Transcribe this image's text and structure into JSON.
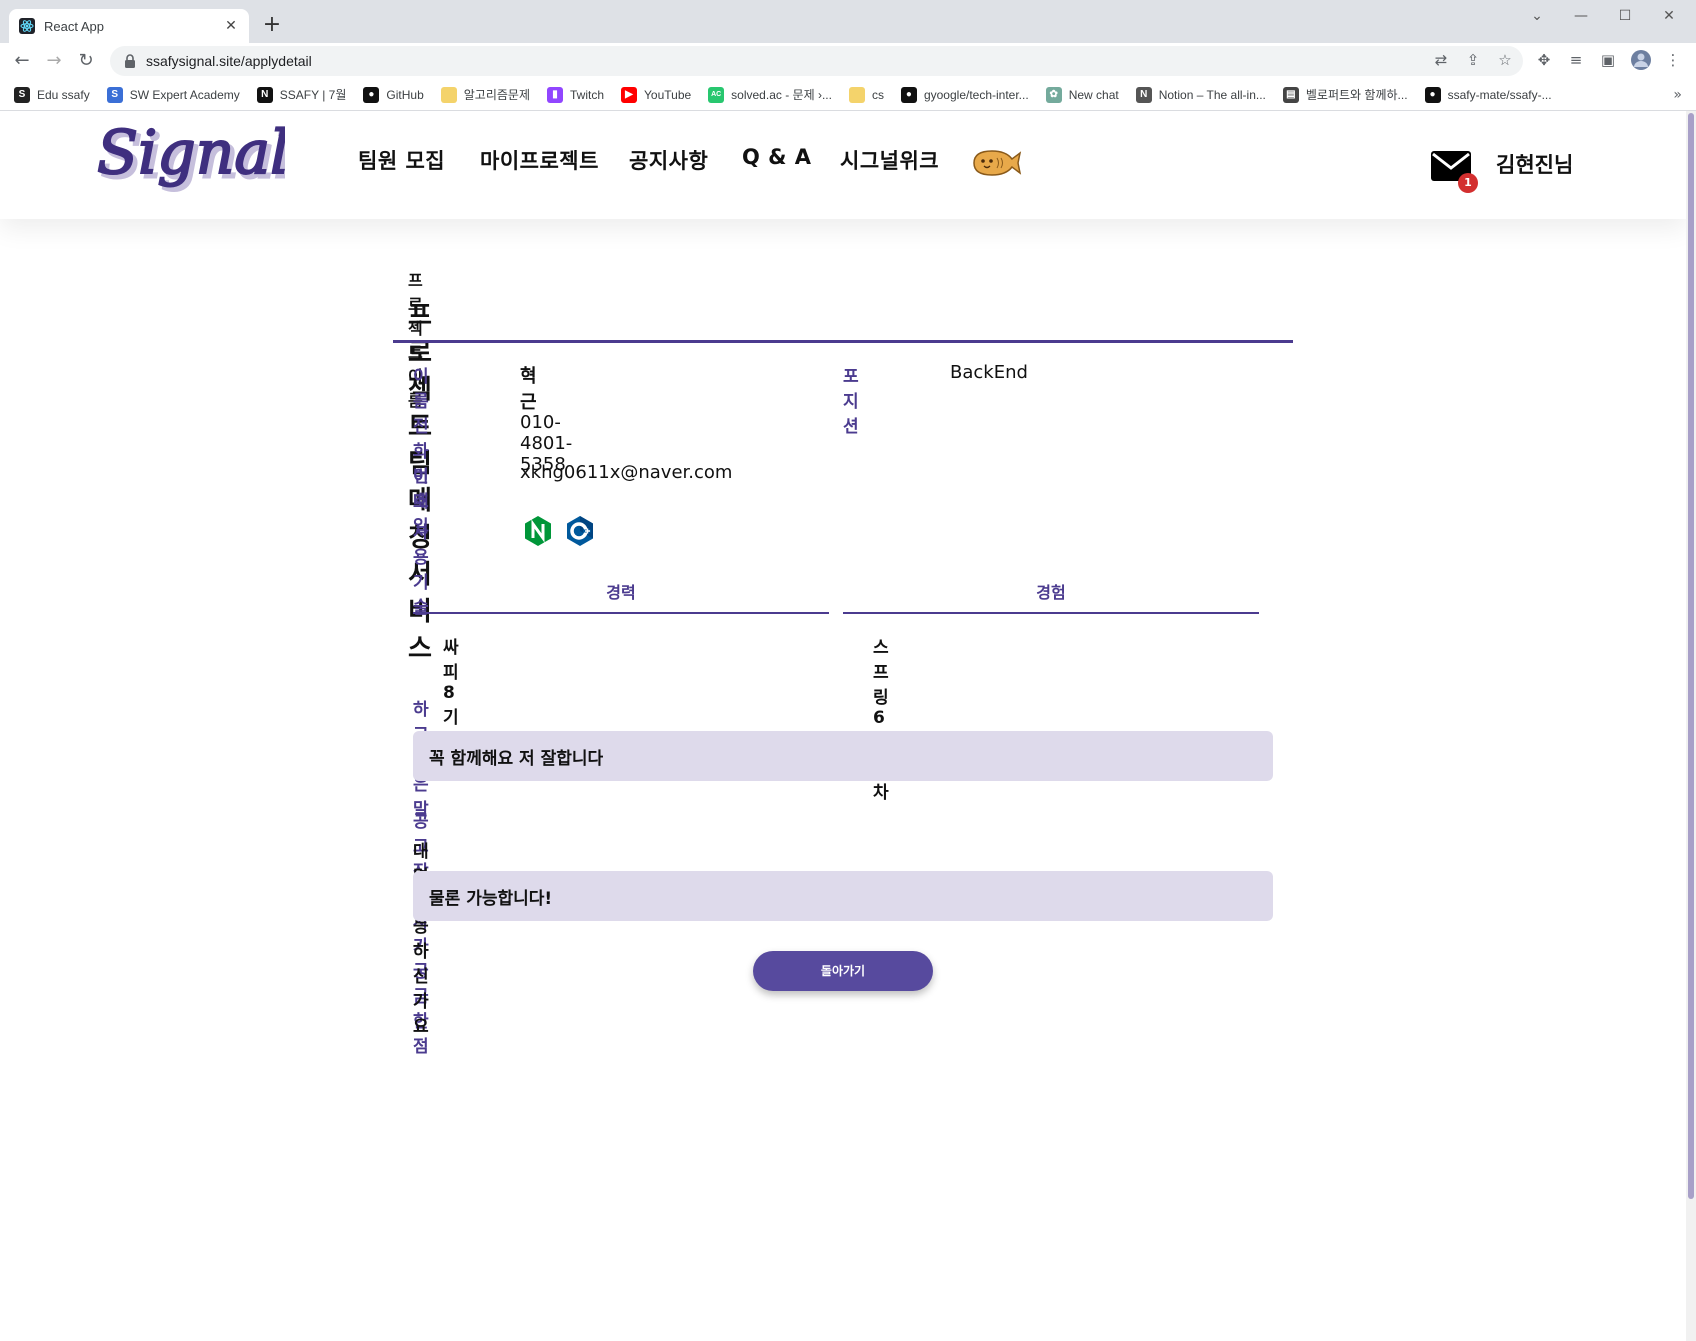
{
  "browser": {
    "tab_title": "React App",
    "url": "ssafysignal.site/applydetail",
    "bookmarks": [
      {
        "label": "Edu ssafy",
        "icon": "edu-ssafy-icon",
        "color": "#222222"
      },
      {
        "label": "SW Expert Academy",
        "icon": "swea-icon",
        "color": "#3b6fd6"
      },
      {
        "label": "SSAFY | 7월",
        "icon": "notion-icon",
        "color": "#111111"
      },
      {
        "label": "GitHub",
        "icon": "github-icon",
        "color": "#111111"
      },
      {
        "label": "알고리즘문제",
        "icon": "folder-icon",
        "color": "#f4d36b"
      },
      {
        "label": "Twitch",
        "icon": "twitch-icon",
        "color": "#9146ff"
      },
      {
        "label": "YouTube",
        "icon": "youtube-icon",
        "color": "#ff0000"
      },
      {
        "label": "solved.ac - 문제 ›...",
        "icon": "solvedac-icon",
        "color": "#28c76f"
      },
      {
        "label": "cs",
        "icon": "folder-icon",
        "color": "#f4d36b"
      },
      {
        "label": "gyoogle/tech-inter...",
        "icon": "github-icon",
        "color": "#111111"
      },
      {
        "label": "New chat",
        "icon": "chatgpt-icon",
        "color": "#74aa9c"
      },
      {
        "label": "Notion – The all-in...",
        "icon": "notion-icon",
        "color": "#555555"
      },
      {
        "label": "벨로퍼트와 함께하...",
        "icon": "book-icon",
        "color": "#444444"
      },
      {
        "label": "ssafy-mate/ssafy-...",
        "icon": "github-icon",
        "color": "#111111"
      }
    ]
  },
  "header": {
    "logo_text": "Signal",
    "nav": [
      "팀원 모집",
      "마이프로젝트",
      "공지사항",
      "Q & A",
      "시그널위크"
    ],
    "mail_badge": "1",
    "username": "김현진님"
  },
  "apply": {
    "project_label": "프로젝트 이름",
    "project_name": "프로젝트 팀 매칭 서비스",
    "name_label": "이름",
    "name_value": "혁근",
    "position_label": "포지션",
    "position_value": "BackEnd",
    "phone_label": "전화번호",
    "phone_value": "010-4801-5358",
    "email_label": "이메일",
    "email_value": "xkhg0611x@naver.com",
    "skills_label": "사용기술",
    "skills": [
      {
        "name": "nginx",
        "icon": "nginx-icon",
        "color": "#009639"
      },
      {
        "name": "C++",
        "icon": "cplusplus-icon",
        "color": "#00599c"
      }
    ],
    "career_header": "경력",
    "career_items": [
      "싸피 8기"
    ],
    "experience_header": "경험",
    "experience_items": [
      "스프링 6개월차"
    ],
    "message_label": "하고싶은 말",
    "message_value": "꼭 함께해요 저 잘합니다",
    "qa_label": "공고 작성자가 궁금한 점",
    "question": "대면 가능하신가요",
    "answer": "물론 가능합니다!",
    "back_button": "돌아가기"
  },
  "colors": {
    "accent": "#4b3b8f",
    "button": "#574a9e",
    "answer_bg": "#dedaeb"
  }
}
